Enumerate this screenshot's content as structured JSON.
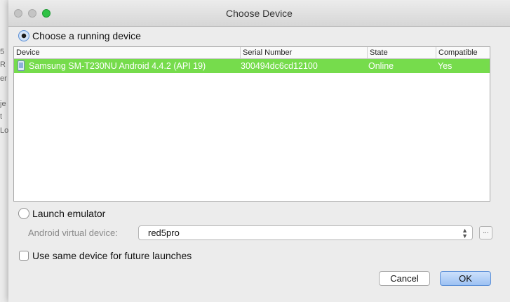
{
  "background": {
    "fragments": [
      "5",
      "R",
      "er",
      "je",
      "t",
      "Lo"
    ]
  },
  "window": {
    "title": "Choose Device"
  },
  "running": {
    "label": "Choose a running device",
    "selected": true
  },
  "table": {
    "columns": [
      "Device",
      "Serial Number",
      "State",
      "Compatible"
    ],
    "rows": [
      {
        "device": "Samsung SM-T230NU Android 4.4.2 (API 19)",
        "serial": "300494dc6cd12100",
        "state": "Online",
        "compatible": "Yes",
        "icon": "tablet-icon"
      }
    ]
  },
  "emulator": {
    "label": "Launch emulator",
    "selected": false,
    "avd_label": "Android virtual device:",
    "avd_value": "red5pro",
    "browse_label": "..."
  },
  "same_device": {
    "label": "Use same device for future launches",
    "checked": false
  },
  "buttons": {
    "cancel": "Cancel",
    "ok": "OK"
  },
  "colors": {
    "selection": "#76dc4c",
    "accent": "#5a8fd6"
  }
}
